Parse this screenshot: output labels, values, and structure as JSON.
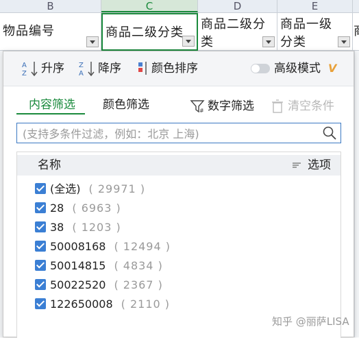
{
  "sheet": {
    "column_letters": [
      "B",
      "C",
      "D",
      "E"
    ],
    "headers": [
      "物品编号",
      "商品二级分类",
      "商品二级分类",
      "商品一级分类",
      "商"
    ]
  },
  "filter_panel": {
    "sort": {
      "ascending_label": "升序",
      "descending_label": "降序",
      "color_sort_label": "颜色排序",
      "advanced_mode_label": "高级模式",
      "vip_badge": "V"
    },
    "tabs": {
      "content_filter": "内容筛选",
      "color_filter": "颜色筛选",
      "number_filter": "数字筛选",
      "clear_conditions": "清空条件"
    },
    "search": {
      "placeholder": "(支持多条件过滤，例如：北京 上海)",
      "value": ""
    },
    "list": {
      "name_header": "名称",
      "options_label": "选项",
      "items": [
        {
          "label": "(全选)",
          "count": "( 29971 )",
          "checked": true
        },
        {
          "label": "28",
          "count": "( 6963 )",
          "checked": true
        },
        {
          "label": "38",
          "count": "( 1203 )",
          "checked": true
        },
        {
          "label": "50008168",
          "count": "( 12494 )",
          "checked": true
        },
        {
          "label": "50014815",
          "count": "( 4834 )",
          "checked": true
        },
        {
          "label": "50022520",
          "count": "( 2367 )",
          "checked": true
        },
        {
          "label": "122650008",
          "count": "( 2110 )",
          "checked": true
        }
      ]
    }
  },
  "watermark": "知乎 @丽萨LISA",
  "colors": {
    "accent_green": "#1a8a3c",
    "checkbox_blue": "#3b7fd4",
    "vip_orange": "#e8a13a"
  }
}
